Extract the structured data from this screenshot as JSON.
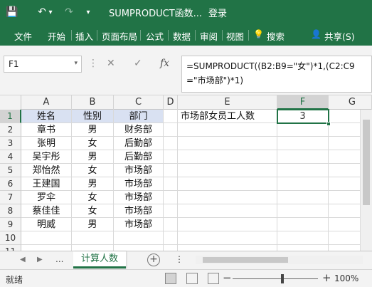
{
  "titlebar": {
    "title": "SUMPRODUCT函数...",
    "login": "登录",
    "save_icon": "💾",
    "undo_icon": "↶",
    "undo_arrow": "▾",
    "redo_icon": "↷",
    "customize_icon": "▾"
  },
  "ribbon": {
    "tabs": [
      "文件",
      "开始",
      "插入",
      "页面布局",
      "公式",
      "数据",
      "审阅",
      "视图"
    ],
    "search_icon": "💡",
    "search": "搜索",
    "share_icon": "👤",
    "share": "共享(S)"
  },
  "formula_bar": {
    "name_box": "F1",
    "name_box_arrow": "▾",
    "more_icon": "⋮",
    "cancel_icon": "✕",
    "enter_icon": "✓",
    "fx_icon": "fx",
    "formula": "=SUMPRODUCT((B2:B9=\"女\")*1,(C2:C9=\"市场部\")*1)"
  },
  "grid": {
    "columns": [
      "A",
      "B",
      "C",
      "D",
      "E",
      "F",
      "G"
    ],
    "rows": [
      "1",
      "2",
      "3",
      "4",
      "5",
      "6",
      "7",
      "8",
      "9",
      "10",
      "11"
    ],
    "headers": [
      "姓名",
      "性别",
      "部门"
    ],
    "data": [
      [
        "章书",
        "男",
        "财务部"
      ],
      [
        "张明",
        "女",
        "后勤部"
      ],
      [
        "吴宇彤",
        "男",
        "后勤部"
      ],
      [
        "郑怡然",
        "女",
        "市场部"
      ],
      [
        "王建国",
        "男",
        "市场部"
      ],
      [
        "罗伞",
        "女",
        "市场部"
      ],
      [
        "蔡佳佳",
        "女",
        "市场部"
      ],
      [
        "明威",
        "男",
        "市场部"
      ]
    ],
    "e1": "市场部女员工人数",
    "f1": "3"
  },
  "sheetbar": {
    "prev_icon": "◀",
    "next_icon": "▶",
    "dots": "...",
    "active_sheet": "计算人数",
    "add_icon": "+",
    "more": "⋮"
  },
  "statusbar": {
    "status": "就绪",
    "zoom_minus": "−",
    "zoom_plus": "+",
    "zoom": "100%",
    "zoom_level": 0.58
  },
  "colors": {
    "accent": "#217346",
    "header_fill": "#d9e1f2"
  }
}
